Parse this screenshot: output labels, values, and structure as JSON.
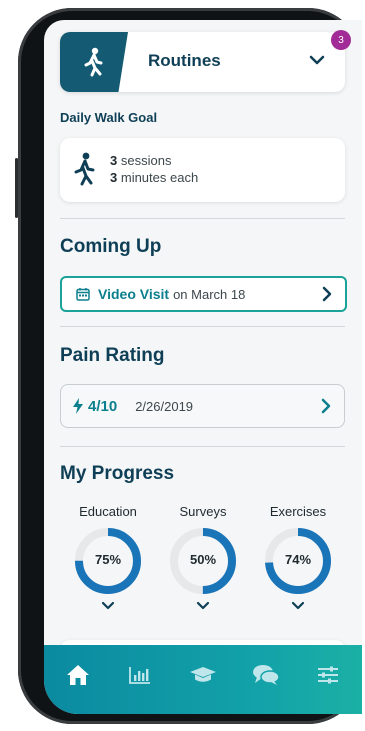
{
  "routines": {
    "title": "Routines",
    "badge_count": "3"
  },
  "daily_walk": {
    "heading": "Daily Walk Goal",
    "sessions_value": "3",
    "sessions_text": "sessions",
    "minutes_value": "3",
    "minutes_text": "minutes each"
  },
  "coming_up": {
    "heading": "Coming Up",
    "visit_title": "Video Visit",
    "visit_date": "on March 18"
  },
  "pain_rating": {
    "heading": "Pain Rating",
    "value": "4/10",
    "date": "2/26/2019"
  },
  "my_progress": {
    "heading": "My Progress",
    "items": [
      {
        "label": "Education",
        "percent_text": "75%",
        "fraction": 0.75
      },
      {
        "label": "Surveys",
        "percent_text": "50%",
        "fraction": 0.5
      },
      {
        "label": "Exercises",
        "percent_text": "74%",
        "fraction": 0.74
      }
    ]
  },
  "tabbar": {
    "tabs": [
      {
        "icon": "home-icon",
        "active": true
      },
      {
        "icon": "bar-chart-icon",
        "active": false
      },
      {
        "icon": "graduation-cap-icon",
        "active": false
      },
      {
        "icon": "chat-bubbles-icon",
        "active": false
      },
      {
        "icon": "sliders-icon",
        "active": false
      }
    ]
  },
  "colors": {
    "brand_dark": "#0f3f56",
    "accent_teal": "#0b7f8d",
    "ring_progress": "#1a74b8",
    "ring_track": "#e6e8ea",
    "badge": "#a12c97"
  }
}
